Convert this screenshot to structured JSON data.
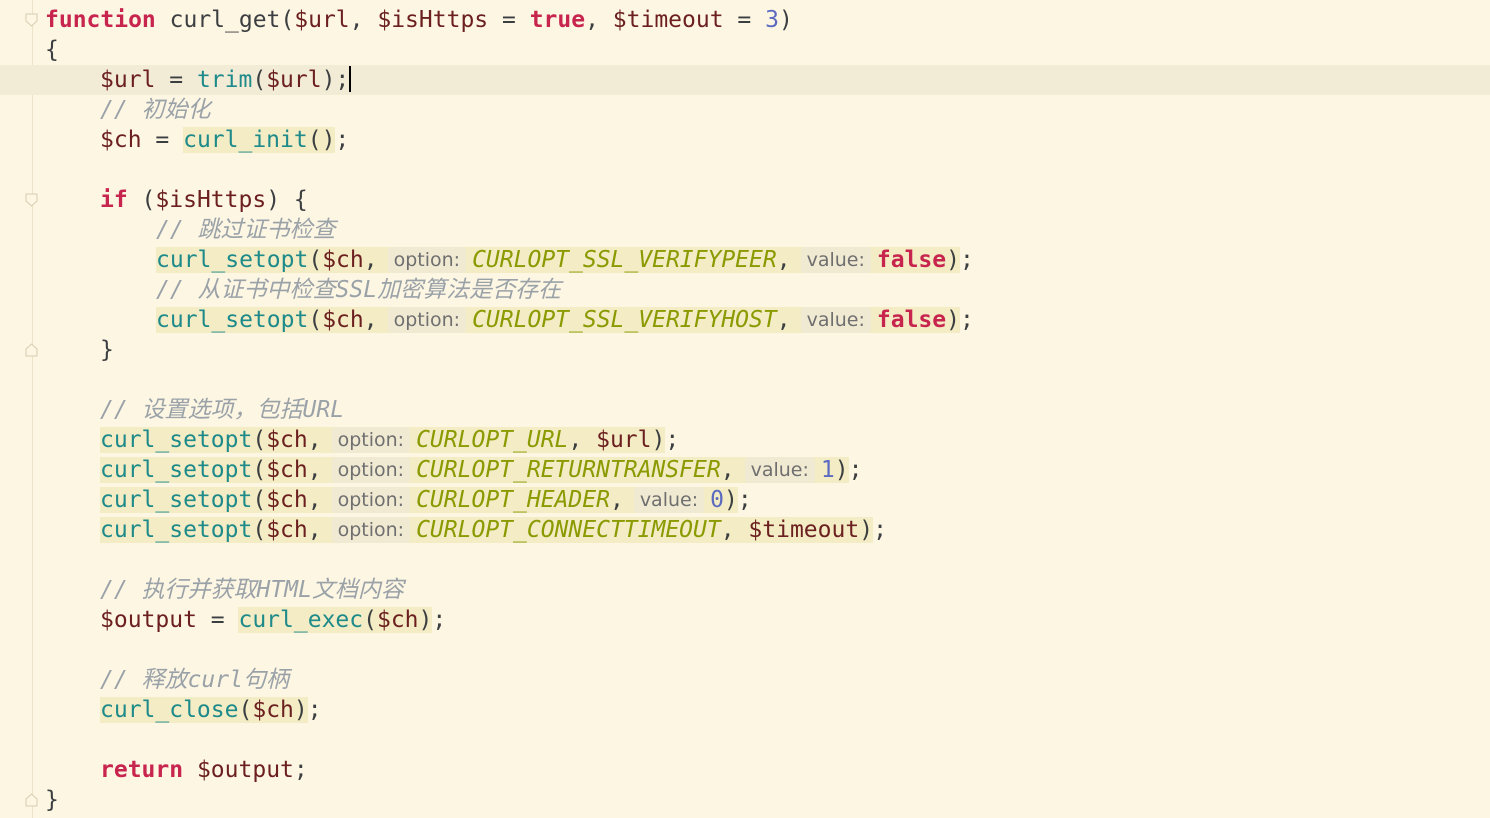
{
  "editor": {
    "language": "php",
    "cursor_line": 3,
    "lines": {
      "l1": {
        "kw": "function",
        "name": " curl_get(",
        "v1": "$url",
        "p1": ", ",
        "v2": "$isHttps",
        "p2": " = ",
        "b1": "true",
        "p3": ", ",
        "v3": "$timeout",
        "p4": " = ",
        "n1": "3",
        "p5": ")"
      },
      "l2": {
        "t": "{"
      },
      "l3": {
        "v1": "$url",
        "p1": " = ",
        "c1": "trim",
        "p2": "(",
        "v2": "$url",
        "p3": ");"
      },
      "l4": {
        "comment": "// 初始化"
      },
      "l5": {
        "v1": "$ch",
        "p1": " = ",
        "c1": "curl_init",
        "p2": "()",
        "p3": ";"
      },
      "l7": {
        "kw": "if",
        "p1": " (",
        "v1": "$isHttps",
        "p2": ") {"
      },
      "l8": {
        "comment": "// 跳过证书检查"
      },
      "l9": {
        "c1": "curl_setopt",
        "p1": "(",
        "v1": "$ch",
        "p2": ",",
        "h1": "option:",
        "k1": "CURLOPT_SSL_VERIFYPEER",
        "p3": ",",
        "h2": "value:",
        "b1": "false",
        "p4": ")",
        "p5": ";"
      },
      "l10": {
        "comment": "// 从证书中检查SSL加密算法是否存在"
      },
      "l11": {
        "c1": "curl_setopt",
        "p1": "(",
        "v1": "$ch",
        "p2": ",",
        "h1": "option:",
        "k1": "CURLOPT_SSL_VERIFYHOST",
        "p3": ",",
        "h2": "value:",
        "b1": "false",
        "p4": ")",
        "p5": ";"
      },
      "l12": {
        "t": "}"
      },
      "l14": {
        "comment": "// 设置选项，包括URL"
      },
      "l15": {
        "c1": "curl_setopt",
        "p1": "(",
        "v1": "$ch",
        "p2": ",",
        "h1": "option:",
        "k1": "CURLOPT_URL",
        "p3": ", ",
        "v2": "$url",
        "p4": ")",
        "p5": ";"
      },
      "l16": {
        "c1": "curl_setopt",
        "p1": "(",
        "v1": "$ch",
        "p2": ",",
        "h1": "option:",
        "k1": "CURLOPT_RETURNTRANSFER",
        "p3": ",",
        "h2": "value:",
        "n1": "1",
        "p4": ")",
        "p5": ";"
      },
      "l17": {
        "c1": "curl_setopt",
        "p1": "(",
        "v1": "$ch",
        "p2": ",",
        "h1": "option:",
        "k1": "CURLOPT_HEADER",
        "p3": ",",
        "h2": "value:",
        "n1": "0",
        "p4": ")",
        "p5": ";"
      },
      "l18": {
        "c1": "curl_setopt",
        "p1": "(",
        "v1": "$ch",
        "p2": ",",
        "h1": "option:",
        "k1": "CURLOPT_CONNECTTIMEOUT",
        "p3": ", ",
        "v2": "$timeout",
        "p4": ")",
        "p5": ";"
      },
      "l20": {
        "comment": "// 执行并获取HTML文档内容"
      },
      "l21": {
        "v1": "$output",
        "p1": " = ",
        "c1": "curl_exec",
        "p2": "(",
        "v2": "$ch",
        "p3": ")",
        "p4": ";"
      },
      "l23": {
        "comment": "// 释放curl句柄"
      },
      "l24": {
        "c1": "curl_close",
        "p1": "(",
        "v1": "$ch",
        "p2": ")",
        "p3": ";"
      },
      "l26": {
        "kw": "return",
        "p1": " ",
        "v1": "$output",
        "p2": ";"
      },
      "l27": {
        "t": "}"
      }
    }
  }
}
